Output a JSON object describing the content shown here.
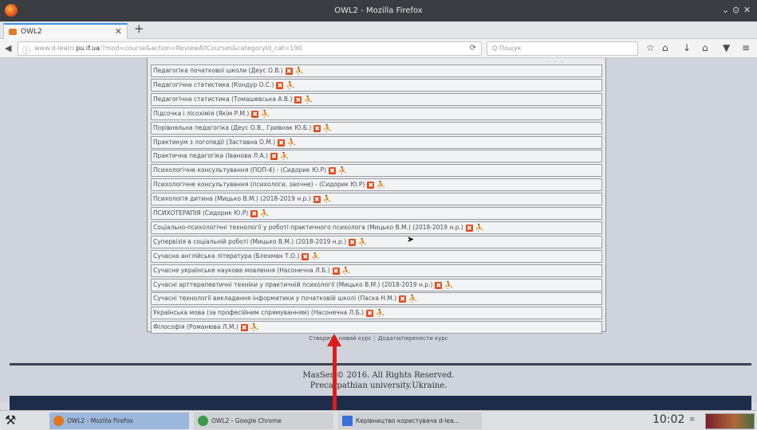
{
  "window": {
    "title": "OWL2 - Mozilla Firefox",
    "controls": [
      "⌄",
      "⊙",
      "✕"
    ]
  },
  "tabs": [
    {
      "label": "OWL2",
      "close": "✕"
    }
  ],
  "newtab": "+",
  "nav": {
    "back": "◀",
    "info": "ⓘ",
    "url_prefix": "www.d-learn.",
    "url_domain": "pu.if.ua",
    "url_rest": "/?mod=course&action=ReviewAllCourses&categoryId_cat=190",
    "reload": "⟳",
    "search_placeholder": "Q Пошук",
    "toolbar_icons": [
      "☆",
      "⌂",
      "↓",
      "⌂",
      "▼",
      "≡"
    ]
  },
  "courses": [
    "Педагогіка початкової школи (Деус О.В.)",
    "Педагогічна статистика (Кондур О.С.)",
    "Педагогічна статистика (Томашевська А.В.)",
    "Підсочка і лісохімія (Якім Р.М.)",
    "Порівняльна педагогіка (Деус О.В., Гривнак Ю.Б.)",
    "Практикум з логопедії (Заставна О.М.)",
    "Практична педагогіка (Іванова Л.А.)",
    "Психологічне консультування (ПОП-4) - (Сидорик Ю.Р)",
    "Психологічне консультування (психологи, заочне) - (Сидорик Ю.Р)",
    "Психологія дитина (Мицько В.М.) (2018-2019 н.р.)",
    "ПСИХОТЕРАПІЯ (Сидорик Ю.Р)",
    "Соціально-психологічні технології у роботі практичного психолога (Мицько В.М.) (2018-2019 н.р.)",
    "Супервізія в соціальній роботі (Мицько В.М.) (2018-2019 н.р.)",
    "Сучасна англійська література (Блехман Т.О.)",
    "Сучасне українське наукове мовлення (Насонечна Л.Б.)",
    "Сучасні арттерапевтичні техніки у практичній психології (Мицько В.М.) (2018-2019 н.р.)",
    "Сучасні технології викладання інформатики у початковій школі (Паска Н.М.)",
    "Українська мова (за професійним спрямуванням) (Насонечна Л.Б.)",
    "Філософія (Романюва Л.М.)"
  ],
  "row_icons": {
    "delete": "✖",
    "users": "⛹"
  },
  "links": {
    "create": "Створити новий курс",
    "sep": "|",
    "access": "Додати/перенести курс"
  },
  "footer": {
    "line1": "MasSer © 2016. All Rights Reserved.",
    "line2": "Precarpathian university.Ukraine."
  },
  "taskbar": {
    "start": "⚒",
    "tasks": [
      {
        "label": "OWL2 - Mozilla Firefox",
        "color": "#e4751c"
      },
      {
        "label": "OWL2 - Google Chrome",
        "color": "#3b9b45"
      },
      {
        "label": "Керівництво користувача d-lea...",
        "color": "#3a6fd8"
      }
    ],
    "clock": "10:02",
    "clock_btn": "≡"
  },
  "colors": {
    "accent": "#3a8ef0",
    "arrow": "#e01b1b",
    "delete_icon": "#e24c1e",
    "footer_bar": "#1d2c49"
  }
}
